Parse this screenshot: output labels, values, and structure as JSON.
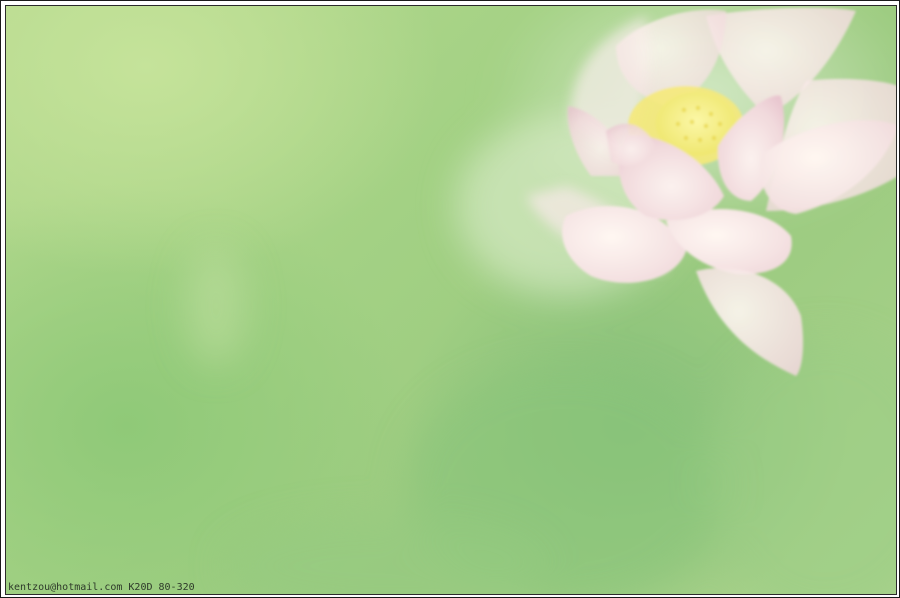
{
  "photo": {
    "subject": "pink-white lotus flower against soft green leaves",
    "caption": "kentzou@hotmail.com K20D 80-320"
  },
  "colors": {
    "background_green": "#a3d184",
    "petal_pink": "#f3dde0",
    "stamen_yellow": "#f4ef7a"
  }
}
